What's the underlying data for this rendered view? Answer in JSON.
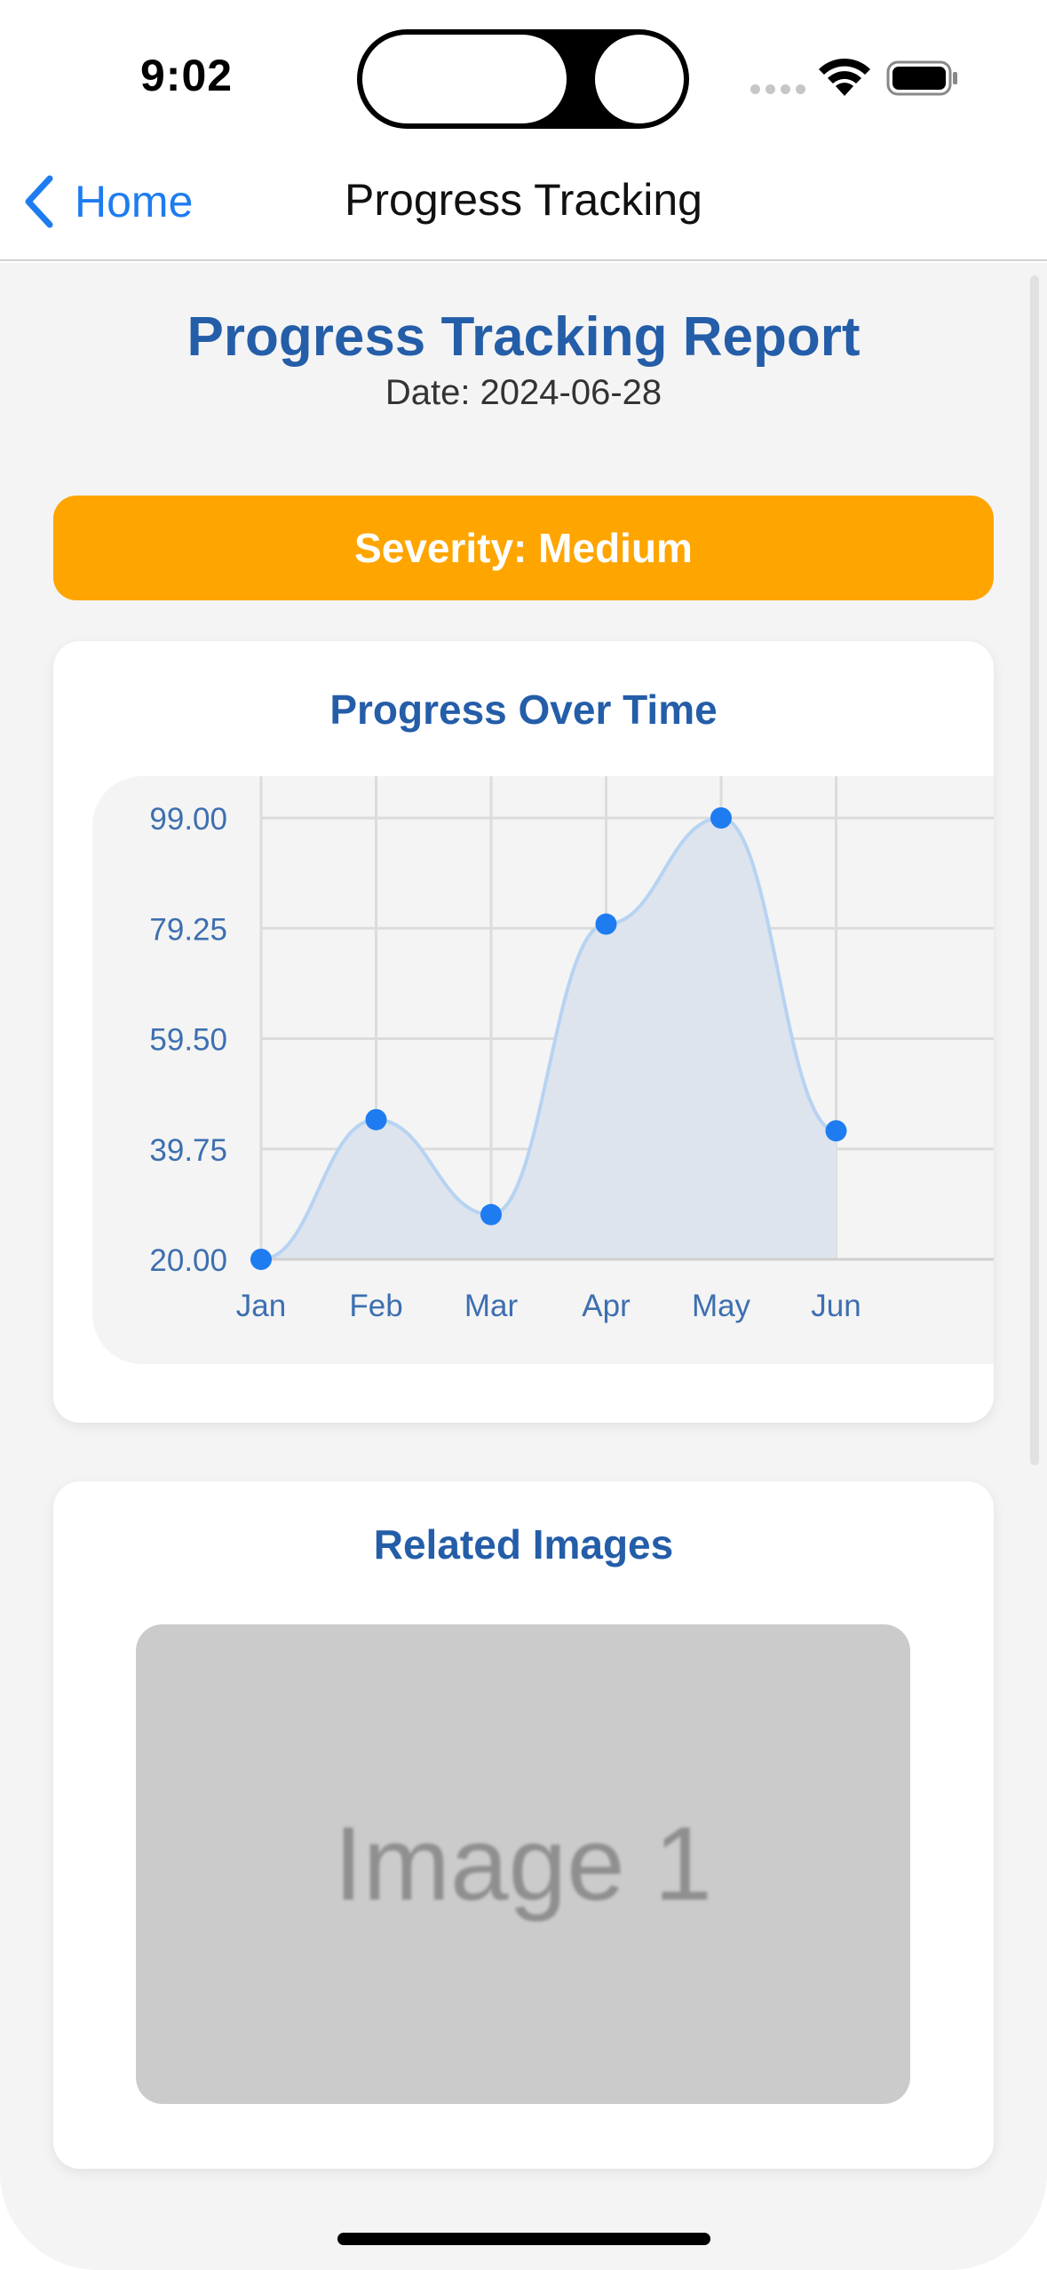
{
  "status_bar": {
    "time": "9:02"
  },
  "nav": {
    "back_label": "Home",
    "title": "Progress Tracking"
  },
  "report": {
    "title": "Progress Tracking Report",
    "date": "Date: 2024-06-28"
  },
  "severity": {
    "label": "Severity: Medium",
    "color": "#fea500"
  },
  "chart_card": {
    "title": "Progress Over Time"
  },
  "chart_data": {
    "type": "line",
    "categories": [
      "Jan",
      "Feb",
      "Mar",
      "Apr",
      "May",
      "Jun"
    ],
    "values": [
      20,
      45,
      28,
      80,
      99,
      43
    ],
    "yticks": [
      "99.00",
      "79.25",
      "59.50",
      "39.75",
      "20.00"
    ],
    "ylim": [
      20,
      99
    ],
    "fill": "area",
    "grid": true,
    "point_color": "#1e7cf0",
    "line_color": "#b7d3f2",
    "area_color": "#dde4ee",
    "title": "",
    "xlabel": "",
    "ylabel": ""
  },
  "images_card": {
    "title": "Related Images",
    "images": [
      {
        "label": "Image 1"
      }
    ]
  },
  "colors": {
    "accent": "#1e7cf0",
    "heading": "#245da8",
    "background": "#f4f4f4"
  }
}
